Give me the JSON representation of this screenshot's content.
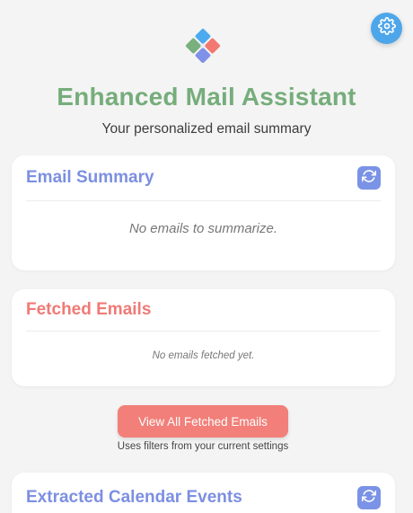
{
  "header": {
    "title": "Enhanced Mail Assistant",
    "subtitle": "Your personalized email summary"
  },
  "email_summary": {
    "title": "Email Summary",
    "empty_text": "No emails to summarize."
  },
  "fetched_emails": {
    "title": "Fetched Emails",
    "empty_text": "No emails fetched yet."
  },
  "actions": {
    "view_all_label": "View All Fetched Emails",
    "filter_note": "Uses filters from your current settings"
  },
  "calendar_events": {
    "title": "Extracted Calendar Events"
  },
  "icons": {
    "settings": "gear-icon",
    "refresh": "refresh-icon",
    "logo": "diamond-logo-icon"
  },
  "colors": {
    "title_green": "#76ad7b",
    "summary_blue": "#7c8fe2",
    "fetched_red": "#f07a76",
    "button_red": "#f27f79",
    "settings_blue": "#4ea6ea"
  }
}
